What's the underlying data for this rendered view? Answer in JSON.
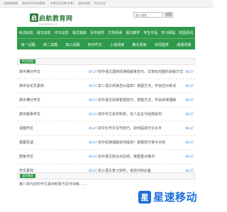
{
  "topbar": {
    "items": [
      "启航教育网",
      "高考(2013年高考)",
      "中考(2013年中考)",
      "高考试卷",
      "作文大全"
    ]
  },
  "header": {
    "logo_mark": "启",
    "logo_text": "启航教育网",
    "logo_sub": "www.qihang.com",
    "search_placeholder": "输入搜索",
    "search_button": "搜索"
  },
  "nav": {
    "row1": [
      "考试动态",
      "语文动态",
      "作文动态",
      "语文题库",
      "写作指导",
      "文学阅读",
      "语文教学",
      "学生作品",
      "学习网站",
      "校园资讯"
    ],
    "row2": [
      "高一试题",
      "高二试题",
      "高三试题",
      "初中作文",
      "小说阅读",
      "散文阅读",
      "诗词鉴赏",
      "成语词典"
    ]
  },
  "section1": {
    "tag": "作文资料",
    "rows": [
      {
        "left": "高中满分作文",
        "date": "06-27",
        "title": "初中语文遇到阅读题解答技巧，文章有完整的讲解方式",
        "date2": "06-27"
      },
      {
        "left": "高中议论文素材",
        "date": "06-27",
        "title": "初二语文阅读怎么提高？掌握方法，学会应对考试",
        "date2": "06-27"
      },
      {
        "left": "高中满分作文",
        "date": "06-27",
        "title": "初中语文阅读答题技巧，掌握方法，学会阅读理解",
        "date2": "06-27"
      },
      {
        "left": "高中叙事作文",
        "date": "06-27",
        "title": "高中作文素材积累，名人名言与经典素材",
        "date2": "06-27"
      },
      {
        "left": "话题作文",
        "date": "06-27",
        "title": "初中生作文写作技巧，如何提高作文水平",
        "date2": "06-27"
      },
      {
        "left": "看图写话",
        "date": "06-27",
        "title": "初中阅读理解如何提高？掌握技巧事半功倍",
        "date2": "06-27"
      },
      {
        "left": "想象作文",
        "date": "06-27",
        "title": "初中语文知识点总结，掌握重点难点",
        "date2": "06-27"
      },
      {
        "left": "作文素材",
        "date": "06-27",
        "title": "初三语文复习资料，考前冲刺必备",
        "date2": "06-27"
      }
    ]
  },
  "section2": {
    "tag": "语文教学",
    "intro": "第八单元初中作文素材积累与写作训练……"
  },
  "watermark": {
    "icon": "星",
    "text": "星速移动"
  },
  "colors": {
    "nav_green": "#2f9a4c",
    "link_blue": "#2f7fd1",
    "watermark_blue": "#1e6fd9"
  }
}
